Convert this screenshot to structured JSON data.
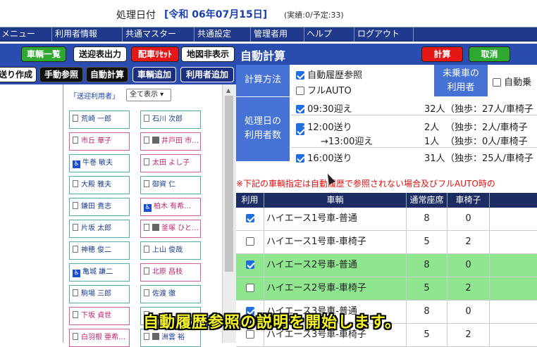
{
  "header": {
    "label": "処理日付",
    "date": "[令和 06年07月15日]",
    "status": "(実績:0/予定:33)"
  },
  "menu": [
    "メニュー",
    "利用者情報",
    "共通マスター",
    "共通設定",
    "管理者用",
    "ヘルプ",
    "ログアウト"
  ],
  "left_buttons": [
    {
      "label": "車輌一覧",
      "style": "green"
    },
    {
      "label": "送迎表出力",
      "style": "white"
    },
    {
      "label": "配車ﾘｾｯﾄ",
      "style": "red"
    },
    {
      "label": "地図非表示",
      "style": "white"
    },
    {
      "label": "送り作成",
      "style": "white"
    },
    {
      "label": "手動参照",
      "style": "black"
    },
    {
      "label": "自動計算",
      "style": "black"
    },
    {
      "label": "車輌追加",
      "style": "navy"
    },
    {
      "label": "利用者追加",
      "style": "navy"
    }
  ],
  "user_list": {
    "header": "「送迎利用者」",
    "filter": "全て表示",
    "users": [
      {
        "name": "荒崎 一郎",
        "color": "teal",
        "icon": "doc"
      },
      {
        "name": "石川 次郎",
        "color": "teal",
        "icon": "doc"
      },
      {
        "name": "市丘 華子",
        "color": "pink",
        "icon": "doc"
      },
      {
        "name": "井戸田 市…",
        "color": "pink",
        "icon": "calc"
      },
      {
        "name": "牛巻 敏夫",
        "color": "teal",
        "icon": "wheelchair"
      },
      {
        "name": "太田 よし子",
        "color": "pink",
        "icon": "doc"
      },
      {
        "name": "大殿 雅夫",
        "color": "teal",
        "icon": "doc"
      },
      {
        "name": "御資 仁",
        "color": "teal",
        "icon": "doc"
      },
      {
        "name": "鎌田 貴志",
        "color": "teal",
        "icon": "doc"
      },
      {
        "name": "柏木 有希…",
        "color": "pink",
        "icon": "wheelchair"
      },
      {
        "name": "片坂 太郎",
        "color": "teal",
        "icon": "doc"
      },
      {
        "name": "釜塚 ひと…",
        "color": "pink",
        "icon": "calc"
      },
      {
        "name": "神穂 俊二",
        "color": "teal",
        "icon": "doc"
      },
      {
        "name": "上山 俊哉",
        "color": "teal",
        "icon": "doc"
      },
      {
        "name": "亀城 謙二",
        "color": "teal",
        "icon": "wheelchair"
      },
      {
        "name": "北原 昌枝",
        "color": "pink",
        "icon": "doc"
      },
      {
        "name": "駒場 三郎",
        "color": "teal",
        "icon": "doc"
      },
      {
        "name": "佐渡 徹",
        "color": "teal",
        "icon": "doc"
      },
      {
        "name": "下坂 貞世",
        "color": "pink",
        "icon": "doc"
      },
      {
        "name": "",
        "color": "teal",
        "icon": "doc"
      },
      {
        "name": "白羽根 亜希…",
        "color": "pink",
        "icon": "doc"
      },
      {
        "name": "洲雲 裕",
        "color": "teal",
        "icon": "calc"
      }
    ]
  },
  "right": {
    "title": "自動計算",
    "calc_button": "計算",
    "cancel_button": "取消",
    "method_label": "計算方法",
    "opt_auto_history": "自動履歴参照",
    "opt_full_auto": "フルAUTO",
    "unboarded_label": "未乗車の\n利用者",
    "opt_auto_board": "自動乗",
    "count_label": "処理日の\n利用者数",
    "trips": [
      {
        "checked": true,
        "time": "09:30迎え",
        "count": "32人",
        "detail": "（独歩：27人/車椅子"
      },
      {
        "checked": true,
        "time": "12:00送り",
        "count": "2人",
        "detail": "（独歩：2人/車椅子"
      },
      {
        "checked": false,
        "time": "→13:00迎え",
        "count": "1人",
        "detail": "（独歩：0人/車椅子"
      },
      {
        "checked": true,
        "time": "16:00送り",
        "count": "31人",
        "detail": "（独歩：25人/車椅子"
      }
    ],
    "warning": "※下記の車輌指定は自動履歴で参照されない場合及びフルAUTO時の",
    "table_headers": [
      "利用",
      "車輌",
      "通常座席",
      "車椅子"
    ],
    "vehicles": [
      {
        "checked": true,
        "name": "ハイエース1号車-普通",
        "seats": "8",
        "wheel": "0",
        "hl": false
      },
      {
        "checked": false,
        "name": "ハイエース1号車-車椅子",
        "seats": "5",
        "wheel": "2",
        "hl": false
      },
      {
        "checked": true,
        "name": "ハイエース2号車-普通",
        "seats": "8",
        "wheel": "0",
        "hl": true
      },
      {
        "checked": false,
        "name": "ハイエース2号車-車椅子",
        "seats": "5",
        "wheel": "2",
        "hl": true
      },
      {
        "checked": true,
        "name": "ハイエース3号車-普通",
        "seats": "8",
        "wheel": "0",
        "hl": false
      },
      {
        "checked": false,
        "name": "ハイエース3号車-車椅子",
        "seats": "5",
        "wheel": "2",
        "hl": false
      }
    ]
  },
  "subtitle": "自動履歴参照の説明を開始します。"
}
